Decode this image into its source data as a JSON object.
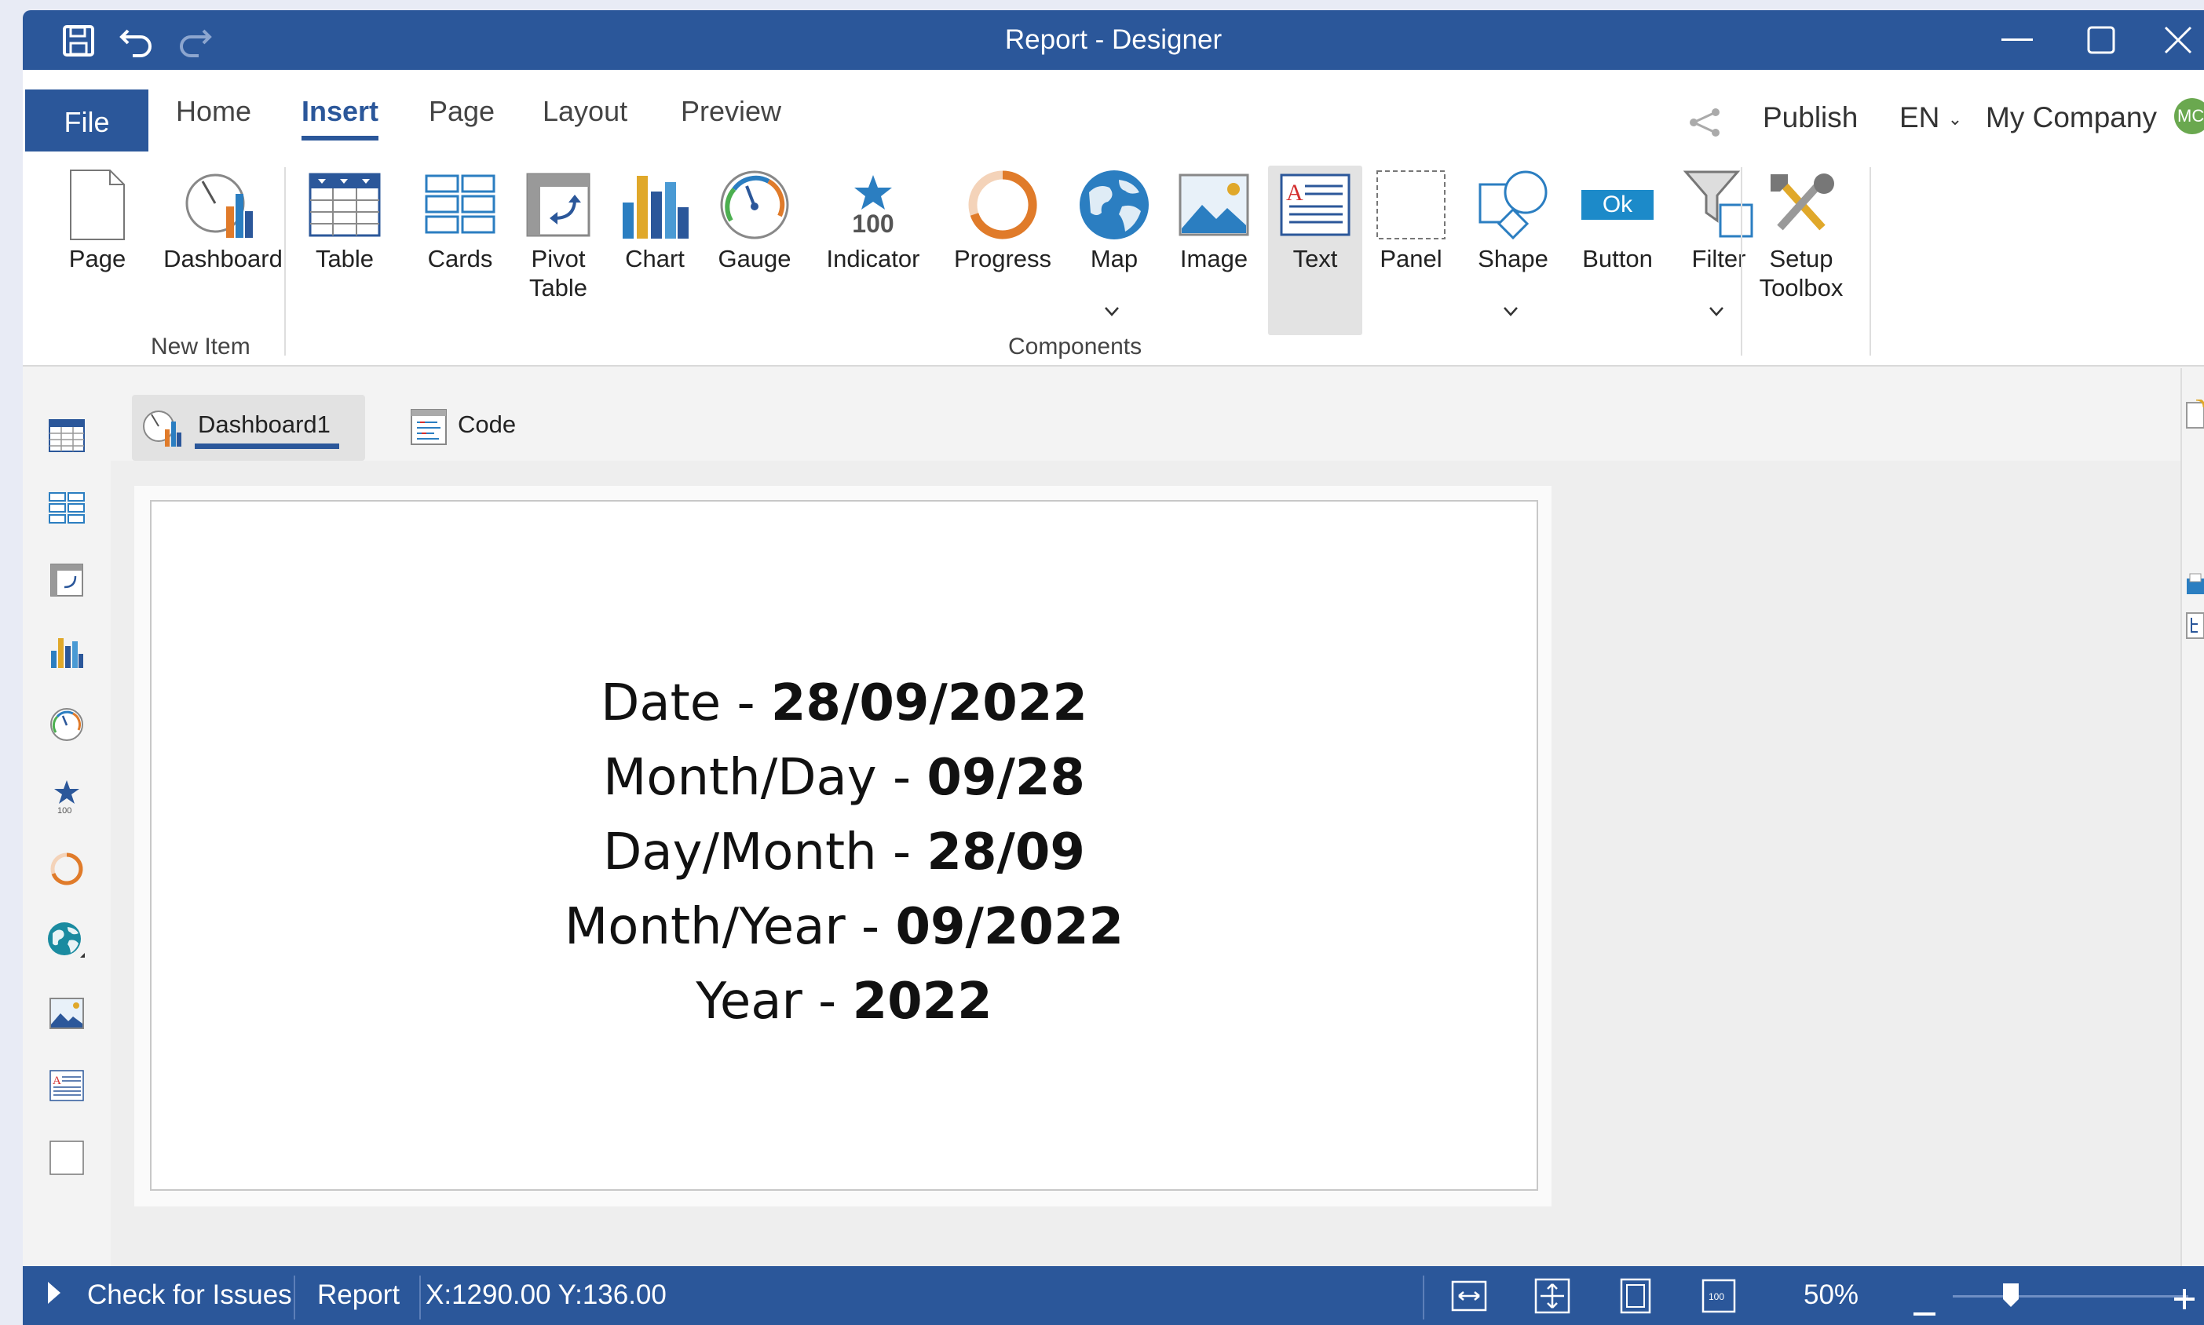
{
  "window": {
    "title": "Report - Designer"
  },
  "ribbon_tabs": {
    "file": "File",
    "home": "Home",
    "insert": "Insert",
    "page": "Page",
    "layout": "Layout",
    "preview": "Preview"
  },
  "header_right": {
    "publish": "Publish",
    "language": "EN",
    "company": "My Company",
    "avatar_initials": "MC"
  },
  "ribbon": {
    "new_item": {
      "page": "Page",
      "dashboard": "Dashboard",
      "group_label": "New Item"
    },
    "components": {
      "table": "Table",
      "cards": "Cards",
      "pivot_table_1": "Pivot",
      "pivot_table_2": "Table",
      "chart": "Chart",
      "gauge": "Gauge",
      "indicator_value": "100",
      "indicator": "Indicator",
      "progress": "Progress",
      "map": "Map",
      "image": "Image",
      "text": "Text",
      "panel": "Panel",
      "shape": "Shape",
      "button_face": "Ok",
      "button": "Button",
      "filter": "Filter",
      "group_label": "Components"
    },
    "setup_toolbox_1": "Setup",
    "setup_toolbox_2": "Toolbox"
  },
  "doc_tabs": {
    "dashboard": "Dashboard1",
    "code": "Code"
  },
  "content": {
    "lines": [
      {
        "label": "Date - ",
        "value": "28/09/2022"
      },
      {
        "label": "Month/Day - ",
        "value": "09/28"
      },
      {
        "label": "Day/Month - ",
        "value": "28/09"
      },
      {
        "label": "Month/Year - ",
        "value": "09/2022"
      },
      {
        "label": "Year - ",
        "value": "2022"
      }
    ]
  },
  "status": {
    "check": "Check for Issues",
    "report": "Report",
    "coords": "X:1290.00 Y:136.00",
    "zoom": "50%"
  },
  "colors": {
    "brand": "#2b579a",
    "accent_orange": "#e07b2a"
  }
}
